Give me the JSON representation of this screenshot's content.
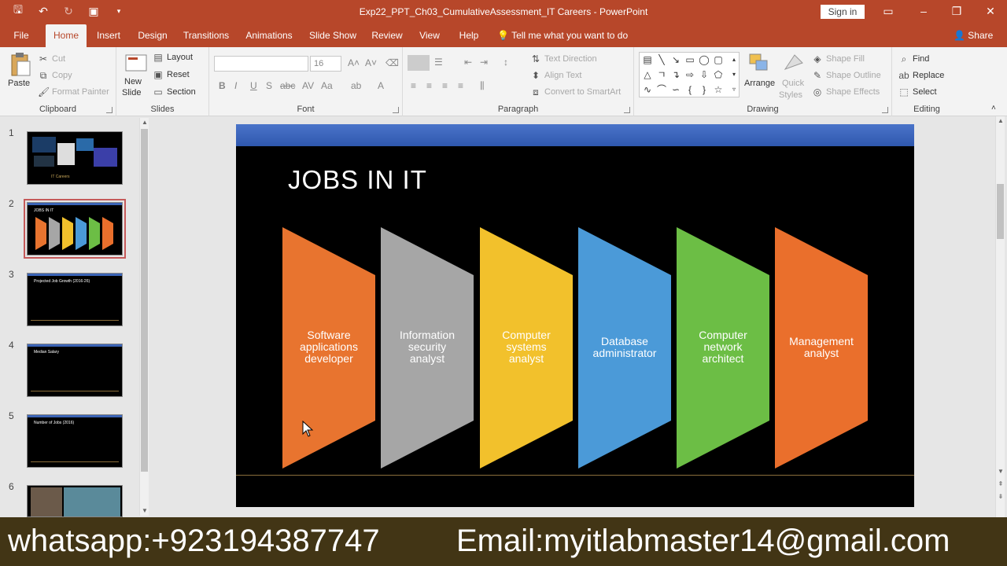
{
  "window": {
    "title": "Exp22_PPT_Ch03_CumulativeAssessment_IT Careers  -  PowerPoint",
    "signin_label": "Sign in"
  },
  "tabs": [
    {
      "label": "File"
    },
    {
      "label": "Home"
    },
    {
      "label": "Insert"
    },
    {
      "label": "Design"
    },
    {
      "label": "Transitions"
    },
    {
      "label": "Animations"
    },
    {
      "label": "Slide Show"
    },
    {
      "label": "Review"
    },
    {
      "label": "View"
    },
    {
      "label": "Help"
    }
  ],
  "tellme": "Tell me what you want to do",
  "share_label": "Share",
  "ribbon": {
    "clipboard": {
      "paste": "Paste",
      "cut": "Cut",
      "copy": "Copy",
      "format_painter": "Format Painter",
      "label": "Clipboard"
    },
    "slides": {
      "new_slide": "New",
      "new_slide2": "Slide",
      "layout": "Layout",
      "reset": "Reset",
      "section": "Section",
      "label": "Slides"
    },
    "font": {
      "font_name": "",
      "font_size": "16",
      "label": "Font"
    },
    "paragraph": {
      "text_direction": "Text Direction",
      "align_text": "Align Text",
      "smartart": "Convert to SmartArt",
      "label": "Paragraph"
    },
    "drawing": {
      "arrange": "Arrange",
      "quick_styles": "Quick",
      "quick_styles2": "Styles",
      "shape_fill": "Shape Fill",
      "shape_outline": "Shape Outline",
      "shape_effects": "Shape Effects",
      "label": "Drawing"
    },
    "editing": {
      "find": "Find",
      "replace": "Replace",
      "select": "Select",
      "label": "Editing"
    }
  },
  "thumbnails": [
    {
      "num": "1",
      "text": "IT Careers"
    },
    {
      "num": "2",
      "text": "JOBS IN IT"
    },
    {
      "num": "3",
      "text": "Projected Job Growth (2016-26)"
    },
    {
      "num": "4",
      "text": "Median Salary"
    },
    {
      "num": "5",
      "text": "Number of Jobs (2016)"
    },
    {
      "num": "6",
      "text": ""
    }
  ],
  "slide": {
    "title": "JOBS IN IT",
    "shapes": [
      {
        "line1": "Software",
        "line2": "applications",
        "line3": "developer",
        "color": "#e8742f"
      },
      {
        "line1": "Information",
        "line2": "security",
        "line3": "analyst",
        "color": "#a6a6a6"
      },
      {
        "line1": "Computer",
        "line2": "systems",
        "line3": "analyst",
        "color": "#f2c12c"
      },
      {
        "line1": "Database",
        "line2": "administrator",
        "line3": "",
        "color": "#4b9ad8"
      },
      {
        "line1": "Computer",
        "line2": "network",
        "line3": "architect",
        "color": "#6cbe45"
      },
      {
        "line1": "Management",
        "line2": "analyst",
        "line3": "",
        "color": "#ea6f2c"
      }
    ]
  },
  "banner": {
    "whatsapp": "whatsapp:+923194387747",
    "email": "Email:myitlabmaster14@gmail.com"
  }
}
